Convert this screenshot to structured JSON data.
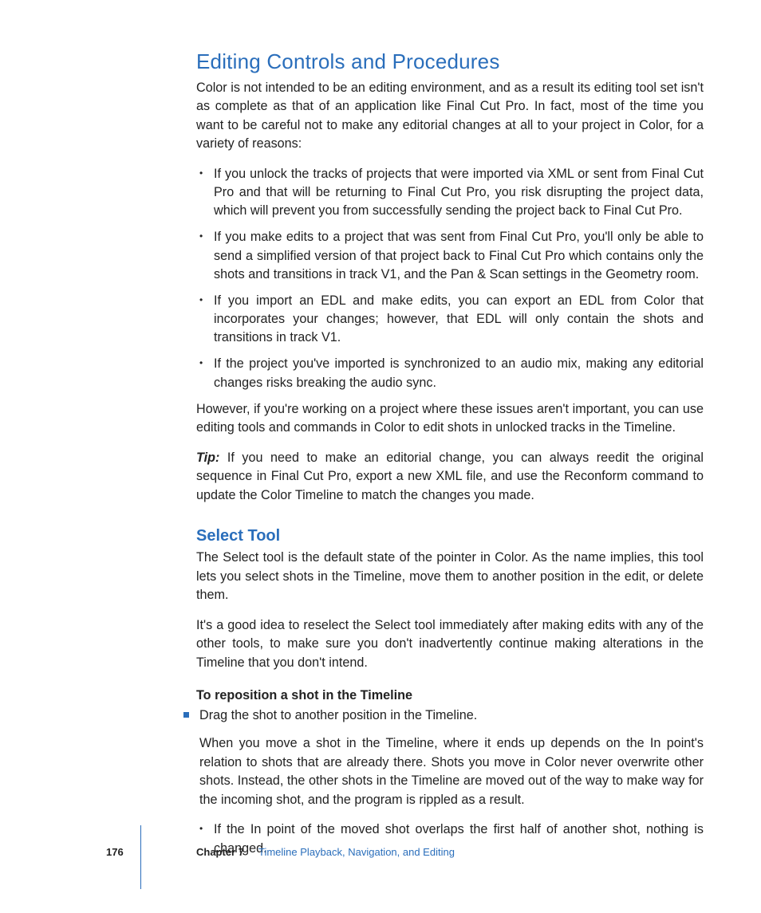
{
  "heading1": "Editing Controls and Procedures",
  "intro": "Color is not intended to be an editing environment, and as a result its editing tool set isn't as complete as that of an application like Final Cut Pro. In fact, most of the time you want to be careful not to make any editorial changes at all to your project in Color, for a variety of reasons:",
  "bullets": [
    "If you unlock the tracks of projects that were imported via XML or sent from Final Cut Pro and that will be returning to Final Cut Pro, you risk disrupting the project data, which will prevent you from successfully sending the project back to Final Cut Pro.",
    "If you make edits to a project that was sent from Final Cut Pro, you'll only be able to send a simplified version of that project back to Final Cut Pro which contains only the shots and transitions in track V1, and the Pan & Scan settings in the Geometry room.",
    "If you import an EDL and make edits, you can export an EDL from Color that incorporates your changes; however, that EDL will only contain the shots and transitions in track V1.",
    "If the project you've imported is synchronized to an audio mix, making any editorial changes risks breaking the audio sync."
  ],
  "however": "However, if you're working on a project where these issues aren't important, you can use editing tools and commands in Color to edit shots in unlocked tracks in the Timeline.",
  "tip_label": "Tip:",
  "tip_text": "  If you need to make an editorial change, you can always reedit the original sequence in Final Cut Pro, export a new XML file, and use the Reconform command to update the Color Timeline to match the changes you made.",
  "heading2": "Select Tool",
  "select_p1": "The Select tool is the default state of the pointer in Color. As the name implies, this tool lets you select shots in the Timeline, move them to another position in the edit, or delete them.",
  "select_p2": "It's a good idea to reselect the Select tool immediately after making edits with any of the other tools, to make sure you don't inadvertently continue making alterations in the Timeline that you don't intend.",
  "step_title": "To reposition a shot in the Timeline",
  "step_bullet": "Drag the shot to another position in the Timeline.",
  "step_p1": "When you move a shot in the Timeline, where it ends up depends on the In point's relation to shots that are already there. Shots you move in Color never overwrite other shots. Instead, the other shots in the Timeline are moved out of the way to make way for the incoming shot, and the program is rippled as a result.",
  "sub_bullet": "If the In point of the moved shot overlaps the first half of another shot, nothing is changed.",
  "footer": {
    "page": "176",
    "chapter_label": "Chapter 7",
    "chapter_title": "Timeline Playback, Navigation, and Editing"
  }
}
